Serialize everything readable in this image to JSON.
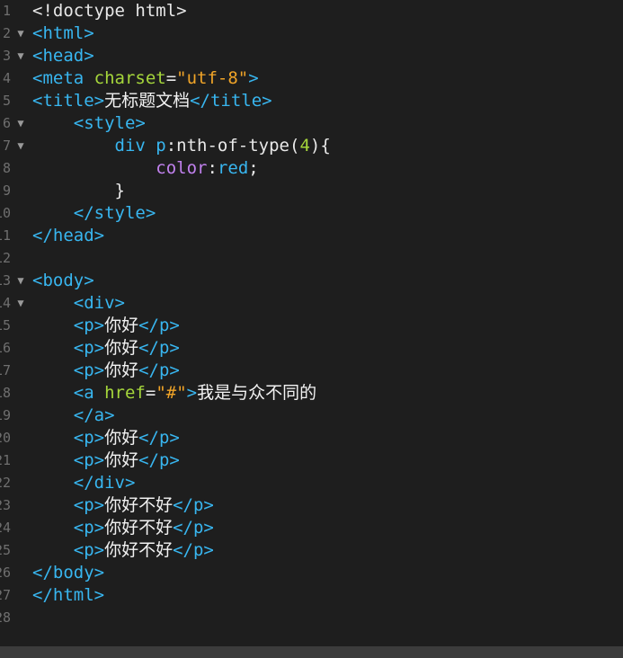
{
  "editor": {
    "lines": [
      {
        "num": "1",
        "fold": false,
        "tokens": [
          {
            "t": "text",
            "v": "<!doctype html>"
          }
        ]
      },
      {
        "num": "2",
        "fold": true,
        "tokens": [
          {
            "t": "tag",
            "v": "<html>"
          }
        ]
      },
      {
        "num": "3",
        "fold": true,
        "tokens": [
          {
            "t": "tag",
            "v": "<head>"
          }
        ]
      },
      {
        "num": "4",
        "fold": false,
        "tokens": [
          {
            "t": "tag",
            "v": "<meta "
          },
          {
            "t": "attr",
            "v": "charset"
          },
          {
            "t": "text",
            "v": "="
          },
          {
            "t": "str",
            "v": "\"utf-8\""
          },
          {
            "t": "tag",
            "v": ">"
          }
        ]
      },
      {
        "num": "5",
        "fold": false,
        "tokens": [
          {
            "t": "tag",
            "v": "<title>"
          },
          {
            "t": "cjk",
            "v": "无标题文档"
          },
          {
            "t": "tag",
            "v": "</title>"
          }
        ]
      },
      {
        "num": "6",
        "fold": true,
        "tokens": [
          {
            "t": "text",
            "v": "    "
          },
          {
            "t": "tag",
            "v": "<style>"
          }
        ]
      },
      {
        "num": "7",
        "fold": true,
        "tokens": [
          {
            "t": "text",
            "v": "        "
          },
          {
            "t": "sel",
            "v": "div p"
          },
          {
            "t": "text",
            "v": ":nth-of-type("
          },
          {
            "t": "num",
            "v": "4"
          },
          {
            "t": "text",
            "v": "){"
          }
        ]
      },
      {
        "num": "8",
        "fold": false,
        "tokens": [
          {
            "t": "text",
            "v": "            "
          },
          {
            "t": "prop",
            "v": "color"
          },
          {
            "t": "text",
            "v": ":"
          },
          {
            "t": "val",
            "v": "red"
          },
          {
            "t": "text",
            "v": ";"
          }
        ]
      },
      {
        "num": "9",
        "fold": false,
        "tokens": [
          {
            "t": "text",
            "v": "        }"
          }
        ]
      },
      {
        "num": "10",
        "fold": false,
        "tokens": [
          {
            "t": "text",
            "v": "    "
          },
          {
            "t": "tag",
            "v": "</style>"
          }
        ]
      },
      {
        "num": "11",
        "fold": false,
        "tokens": [
          {
            "t": "tag",
            "v": "</head>"
          }
        ]
      },
      {
        "num": "12",
        "fold": false,
        "tokens": []
      },
      {
        "num": "13",
        "fold": true,
        "tokens": [
          {
            "t": "tag",
            "v": "<body>"
          }
        ]
      },
      {
        "num": "14",
        "fold": true,
        "tokens": [
          {
            "t": "text",
            "v": "    "
          },
          {
            "t": "tag",
            "v": "<div>"
          }
        ]
      },
      {
        "num": "15",
        "fold": false,
        "tokens": [
          {
            "t": "text",
            "v": "    "
          },
          {
            "t": "tag",
            "v": "<p>"
          },
          {
            "t": "cjk",
            "v": "你好"
          },
          {
            "t": "tag",
            "v": "</p>"
          }
        ]
      },
      {
        "num": "16",
        "fold": false,
        "tokens": [
          {
            "t": "text",
            "v": "    "
          },
          {
            "t": "tag",
            "v": "<p>"
          },
          {
            "t": "cjk",
            "v": "你好"
          },
          {
            "t": "tag",
            "v": "</p>"
          }
        ]
      },
      {
        "num": "17",
        "fold": false,
        "tokens": [
          {
            "t": "text",
            "v": "    "
          },
          {
            "t": "tag",
            "v": "<p>"
          },
          {
            "t": "cjk",
            "v": "你好"
          },
          {
            "t": "tag",
            "v": "</p>"
          }
        ]
      },
      {
        "num": "18",
        "fold": false,
        "tokens": [
          {
            "t": "text",
            "v": "    "
          },
          {
            "t": "tag",
            "v": "<a "
          },
          {
            "t": "attr",
            "v": "href"
          },
          {
            "t": "text",
            "v": "="
          },
          {
            "t": "str",
            "v": "\"#\""
          },
          {
            "t": "tag",
            "v": ">"
          },
          {
            "t": "cjk",
            "v": "我是与众不同的"
          }
        ]
      },
      {
        "num": "19",
        "fold": false,
        "tokens": [
          {
            "t": "text",
            "v": "    "
          },
          {
            "t": "tag",
            "v": "</a>"
          }
        ]
      },
      {
        "num": "20",
        "fold": false,
        "tokens": [
          {
            "t": "text",
            "v": "    "
          },
          {
            "t": "tag",
            "v": "<p>"
          },
          {
            "t": "cjk",
            "v": "你好"
          },
          {
            "t": "tag",
            "v": "</p>"
          }
        ]
      },
      {
        "num": "21",
        "fold": false,
        "tokens": [
          {
            "t": "text",
            "v": "    "
          },
          {
            "t": "tag",
            "v": "<p>"
          },
          {
            "t": "cjk",
            "v": "你好"
          },
          {
            "t": "tag",
            "v": "</p>"
          }
        ]
      },
      {
        "num": "22",
        "fold": false,
        "tokens": [
          {
            "t": "text",
            "v": "    "
          },
          {
            "t": "tag",
            "v": "</div>"
          }
        ]
      },
      {
        "num": "23",
        "fold": false,
        "tokens": [
          {
            "t": "text",
            "v": "    "
          },
          {
            "t": "tag",
            "v": "<p>"
          },
          {
            "t": "cjk",
            "v": "你好不好"
          },
          {
            "t": "tag",
            "v": "</p>"
          }
        ]
      },
      {
        "num": "24",
        "fold": false,
        "tokens": [
          {
            "t": "text",
            "v": "    "
          },
          {
            "t": "tag",
            "v": "<p>"
          },
          {
            "t": "cjk",
            "v": "你好不好"
          },
          {
            "t": "tag",
            "v": "</p>"
          }
        ]
      },
      {
        "num": "25",
        "fold": false,
        "tokens": [
          {
            "t": "text",
            "v": "    "
          },
          {
            "t": "tag",
            "v": "<p>"
          },
          {
            "t": "cjk",
            "v": "你好不好"
          },
          {
            "t": "tag",
            "v": "</p>"
          }
        ]
      },
      {
        "num": "26",
        "fold": false,
        "tokens": [
          {
            "t": "tag",
            "v": "</body>"
          }
        ]
      },
      {
        "num": "27",
        "fold": false,
        "tokens": [
          {
            "t": "tag",
            "v": "</html>"
          }
        ]
      },
      {
        "num": "28",
        "fold": false,
        "tokens": []
      }
    ],
    "fold_glyph": "▼"
  },
  "colors": {
    "background": "#1e1e1e",
    "tag": "#38b6f0",
    "attribute": "#a5d63b",
    "string": "#f0a428",
    "property": "#c181ee",
    "gutter": "#6f6f6f",
    "scrollbar": "#3c3c3c"
  },
  "icons": {
    "fold": "fold-arrow-icon"
  }
}
